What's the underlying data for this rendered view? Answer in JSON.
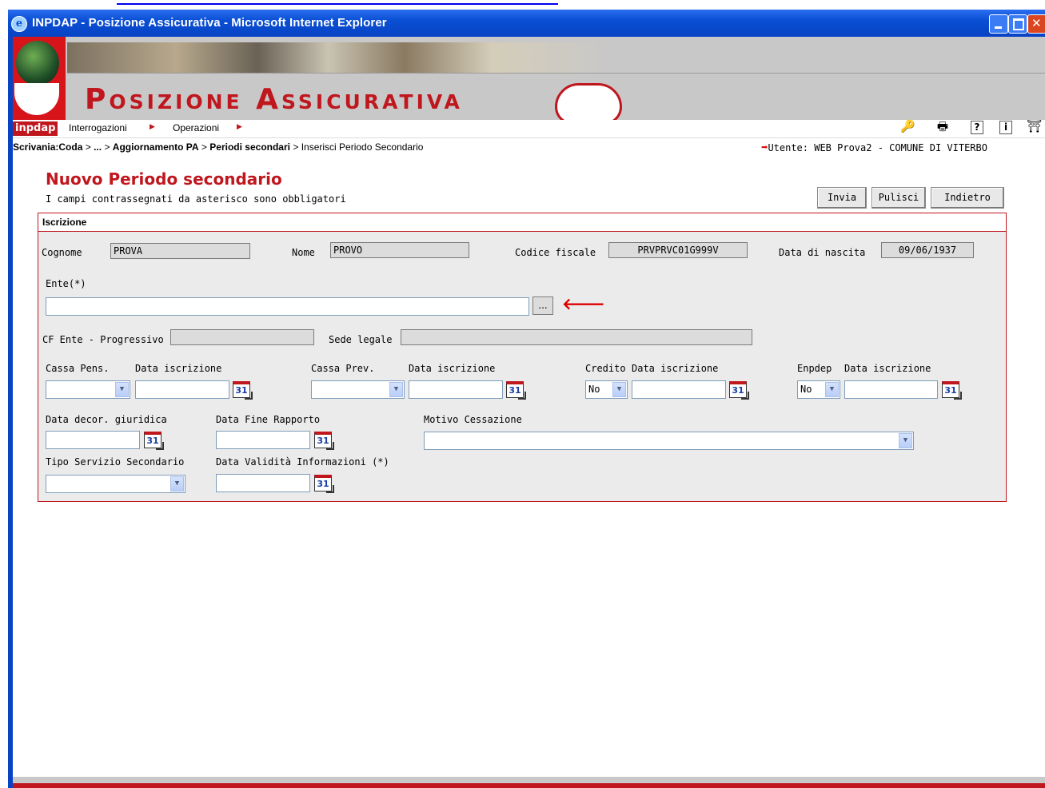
{
  "window": {
    "title": "INPDAP - Posizione Assicurativa - Microsoft Internet Explorer"
  },
  "banner": {
    "brand": "Posizione Assicurativa",
    "logo_text": "inpdap"
  },
  "menu": {
    "items": [
      "Interrogazioni",
      "Operazioni"
    ]
  },
  "toolbar": {
    "icons": [
      "key-icon",
      "printer-icon",
      "help-icon",
      "info-icon",
      "exit-icon"
    ],
    "help_glyph": "?",
    "info_glyph": "i"
  },
  "breadcrumb": {
    "items": [
      "Scrivania:Coda",
      "...",
      "Aggiornamento PA",
      "Periodi secondari",
      "Inserisci Periodo Secondario"
    ],
    "separator": ">"
  },
  "user": {
    "text": "Utente: WEB Prova2 - COMUNE DI VITERBO"
  },
  "page": {
    "title": "Nuovo Periodo secondario",
    "note": "I campi contrassegnati da asterisco sono obbligatori"
  },
  "buttons": {
    "invia": "Invia",
    "pulisci": "Pulisci",
    "indietro": "Indietro"
  },
  "section": {
    "title": "Iscrizione"
  },
  "fields": {
    "cognome": {
      "label": "Cognome",
      "value": "PROVA"
    },
    "nome": {
      "label": "Nome",
      "value": "PROVO"
    },
    "codice_fiscale": {
      "label": "Codice fiscale",
      "value": "PRVPRVC01G999V"
    },
    "data_nascita": {
      "label": "Data di nascita",
      "value": "09/06/1937"
    },
    "ente": {
      "label": "Ente(*)",
      "value": "",
      "lookup": "..."
    },
    "cf_ente": {
      "label": "CF Ente - Progressivo",
      "value": ""
    },
    "sede_legale": {
      "label": "Sede legale",
      "value": ""
    },
    "cassa_pens": {
      "label": "Cassa Pens.",
      "value": ""
    },
    "cassa_pens_data": {
      "label": "Data iscrizione",
      "value": ""
    },
    "cassa_prev": {
      "label": "Cassa Prev.",
      "value": ""
    },
    "cassa_prev_data": {
      "label": "Data iscrizione",
      "value": ""
    },
    "credito": {
      "label": "Credito",
      "value": "No"
    },
    "credito_data": {
      "label": "Data iscrizione",
      "value": ""
    },
    "enpdep": {
      "label": "Enpdep",
      "value": "No"
    },
    "enpdep_data": {
      "label": "Data iscrizione",
      "value": ""
    },
    "data_decor": {
      "label": "Data decor. giuridica",
      "value": ""
    },
    "data_fine": {
      "label": "Data Fine Rapporto",
      "value": ""
    },
    "motivo": {
      "label": "Motivo Cessazione",
      "value": ""
    },
    "tipo_servizio": {
      "label": "Tipo Servizio Secondario",
      "value": ""
    },
    "data_validita": {
      "label": "Data Validità Informazioni (*)",
      "value": ""
    }
  },
  "calendar": {
    "glyph": "31"
  },
  "colors": {
    "accent": "#c0161d",
    "titlebar": "#0a4fd4",
    "panel_bg": "#ebebeb"
  }
}
